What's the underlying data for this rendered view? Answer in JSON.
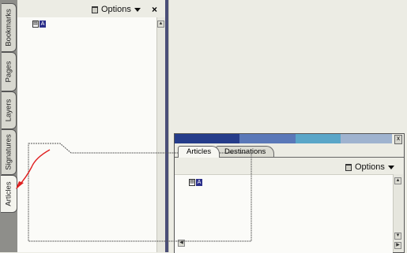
{
  "tabs": [
    {
      "label": "Bookmarks"
    },
    {
      "label": "Pages"
    },
    {
      "label": "Layers"
    },
    {
      "label": "Signatures"
    },
    {
      "label": "Articles"
    }
  ],
  "left_panel": {
    "options_label": "Options",
    "close_symbol": "×",
    "article_glyph": "A"
  },
  "palette": {
    "tabs": [
      {
        "label": "Articles"
      },
      {
        "label": "Destinations"
      }
    ],
    "options_label": "Options",
    "close_symbol": "x",
    "article_glyph": "A",
    "title_colors": [
      "#253c8a",
      "#5a78b8",
      "#5aa6c8",
      "#9fb3cf"
    ]
  },
  "icons": [
    "trash-icon",
    "dropdown-caret-icon",
    "close-icon",
    "article-icon",
    "scroll-up-icon",
    "scroll-down-icon",
    "scroll-left-icon",
    "scroll-right-icon",
    "red-arrow-annotation"
  ],
  "colors": {
    "annotation_arrow": "#e02020",
    "drag_outline": "#555555"
  }
}
